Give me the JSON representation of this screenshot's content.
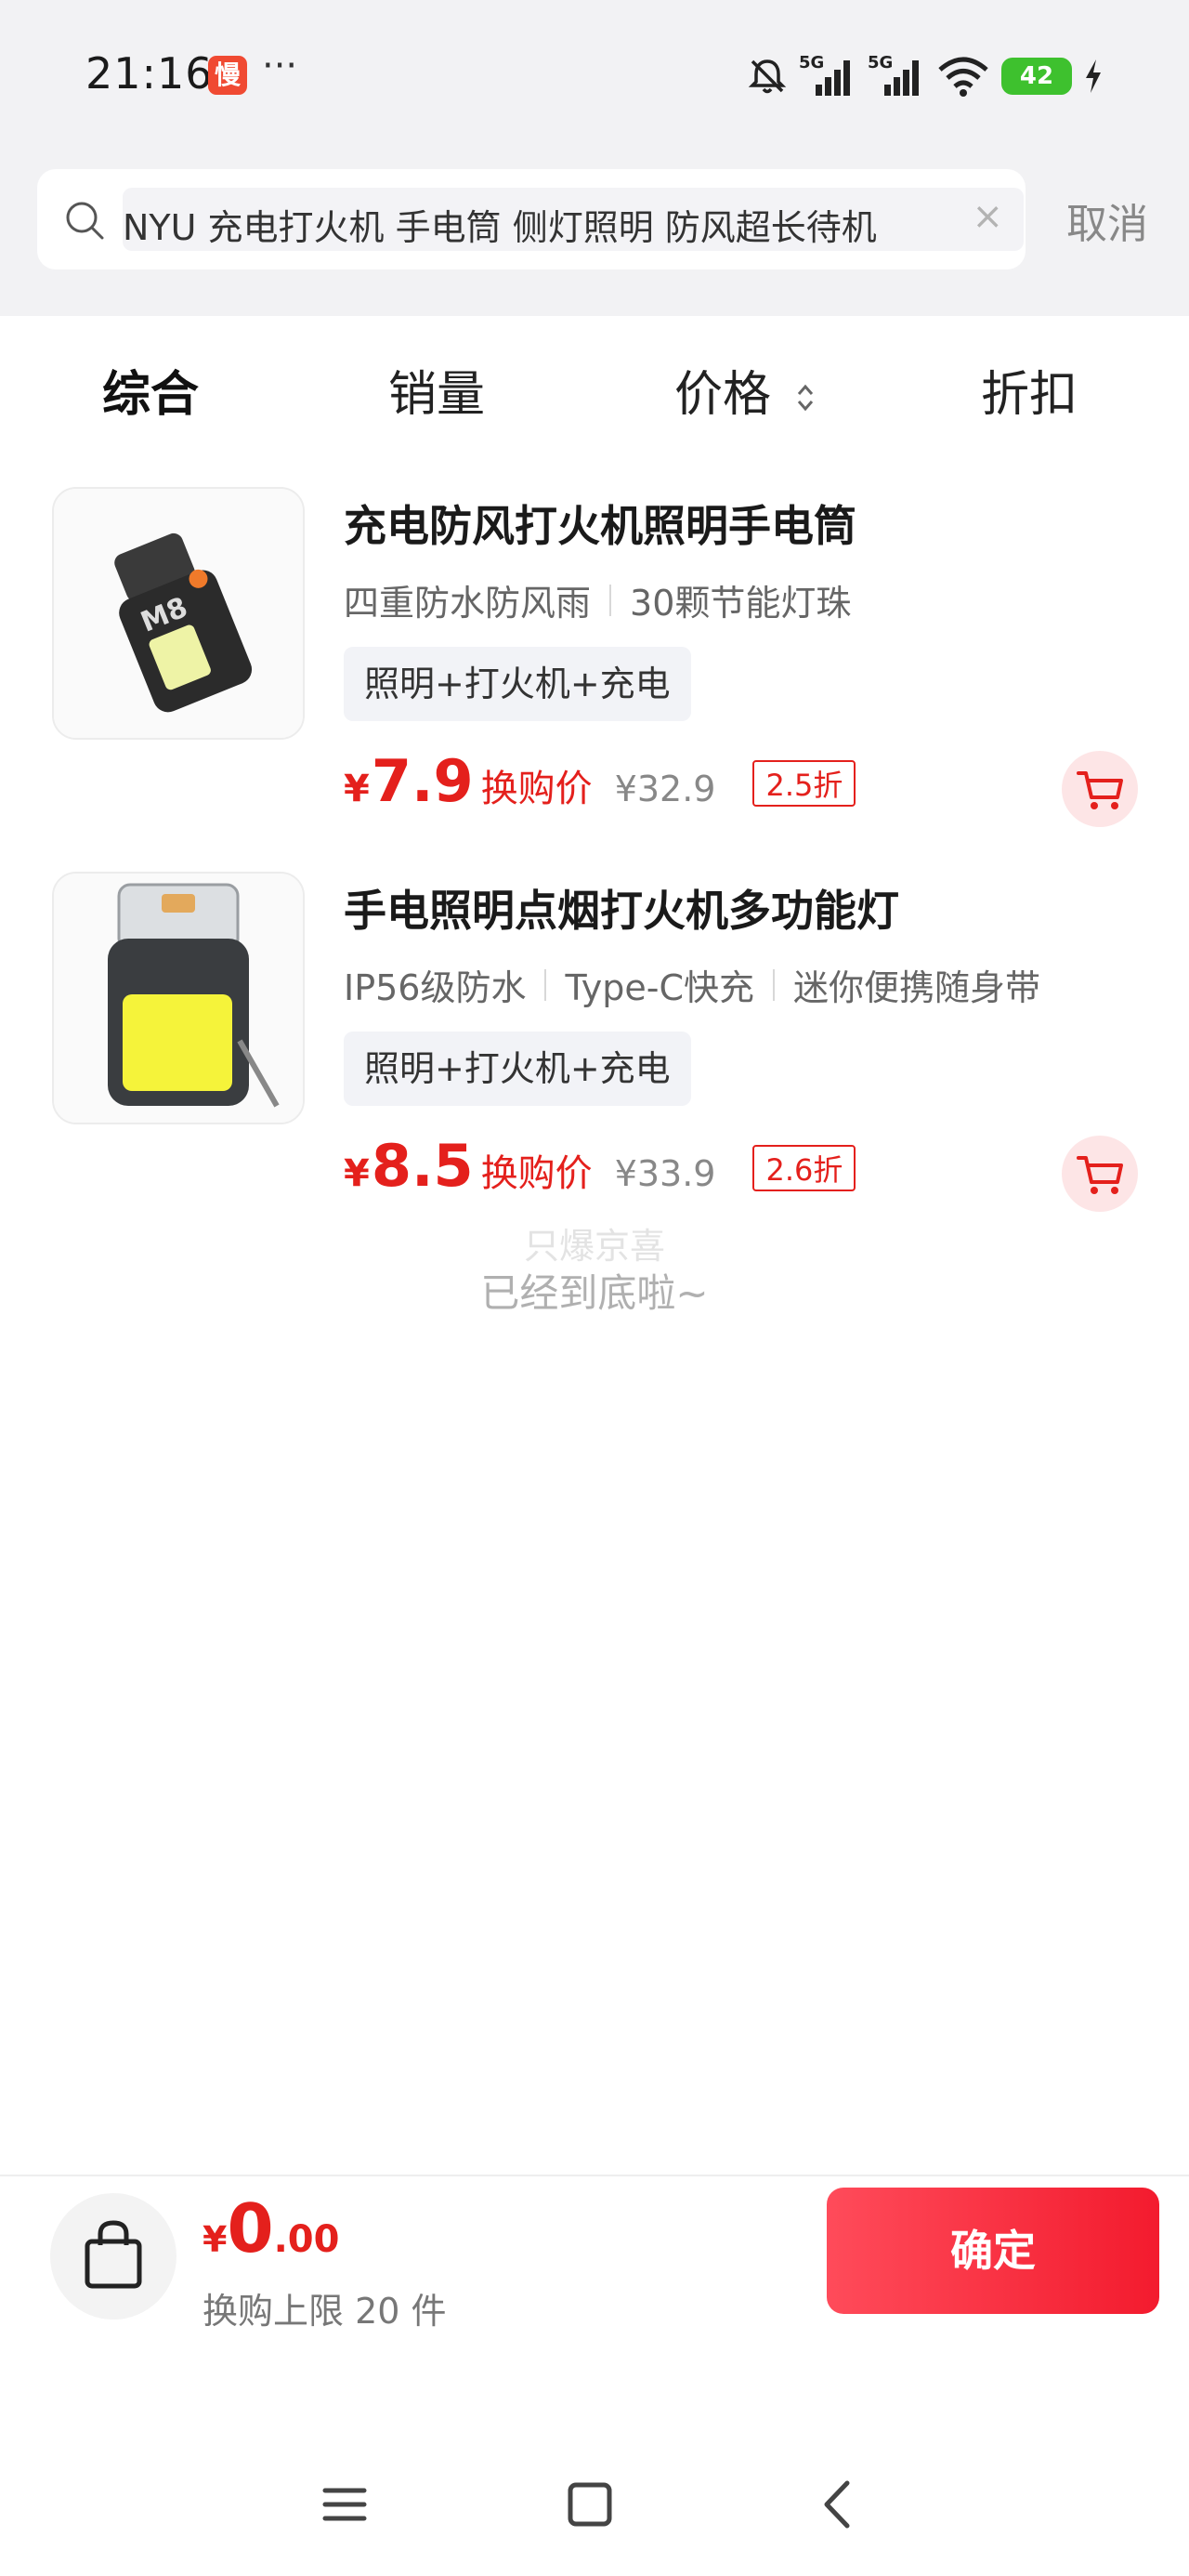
{
  "status_bar": {
    "time": "21:16",
    "app_badge": "慢",
    "dots": "···",
    "signal_label_1": "5G",
    "signal_label_2": "5G",
    "battery": "42"
  },
  "search": {
    "query": "NYU 充电打火机 手电筒 侧灯照明 防风超长待机",
    "cancel_label": "取消"
  },
  "sort": {
    "items": [
      "综合",
      "销量",
      "价格",
      "折扣"
    ],
    "active_index": 0
  },
  "products": [
    {
      "title": "充电防风打火机照明手电筒",
      "features": [
        "四重防水防风雨",
        "30颗节能灯珠"
      ],
      "tag": "照明+打火机+充电",
      "price_symbol": "¥",
      "price": "7.9",
      "price_label": "换购价",
      "original_price": "¥32.9",
      "discount": "2.5折"
    },
    {
      "title": "手电照明点烟打火机多功能灯",
      "features": [
        "IP56级防水",
        "Type-C快充",
        "迷你便携随身带"
      ],
      "tag": "照明+打火机+充电",
      "price_symbol": "¥",
      "price": "8.5",
      "price_label": "换购价",
      "original_price": "¥33.9",
      "discount": "2.6折"
    }
  ],
  "list_end": {
    "faint_text": "只爆京喜",
    "text": "已经到底啦~"
  },
  "bottom_bar": {
    "currency": "¥",
    "total_int": "0",
    "total_dec": ".00",
    "limit_text": "换购上限 20 件",
    "confirm_label": "确定"
  },
  "colors": {
    "accent_red": "#e4201c",
    "confirm_gradient_start": "#ff4b5a",
    "confirm_gradient_end": "#f31b2e",
    "battery_green": "#3ec12e"
  },
  "icons": [
    "search-icon",
    "clear-icon",
    "sort-arrows-icon",
    "cart-icon",
    "shopping-bag-icon",
    "menu-icon",
    "home-icon",
    "back-icon",
    "mute-icon",
    "signal-icon",
    "wifi-icon",
    "charging-icon"
  ]
}
